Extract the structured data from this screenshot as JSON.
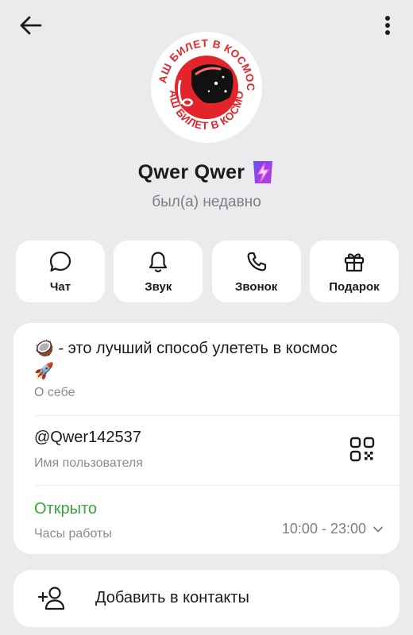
{
  "profile": {
    "name": "Qwer Qwer",
    "status": "был(а) недавно",
    "avatar_text": "ВАШ БИЛЕТ В КОСМОС"
  },
  "actions": [
    {
      "label": "Чат",
      "icon": "chat-bubble-icon"
    },
    {
      "label": "Звук",
      "icon": "bell-icon"
    },
    {
      "label": "Звонок",
      "icon": "phone-icon"
    },
    {
      "label": "Подарок",
      "icon": "gift-icon"
    }
  ],
  "info": {
    "bio": "🥥 - это лучший способ улететь в космос 🚀",
    "bio_caption": "О себе",
    "username": "@Qwer142537",
    "username_caption": "Имя пользователя",
    "open_status": "Открыто",
    "hours_caption": "Часы работы",
    "hours_value": "10:00 - 23:00"
  },
  "add_contact": {
    "label": "Добавить в контакты"
  },
  "colors": {
    "background": "#ebebee",
    "card": "#ffffff",
    "open_green": "#3aa53e",
    "premium_purple": "#8a3cf0",
    "avatar_red": "#e3242b"
  }
}
